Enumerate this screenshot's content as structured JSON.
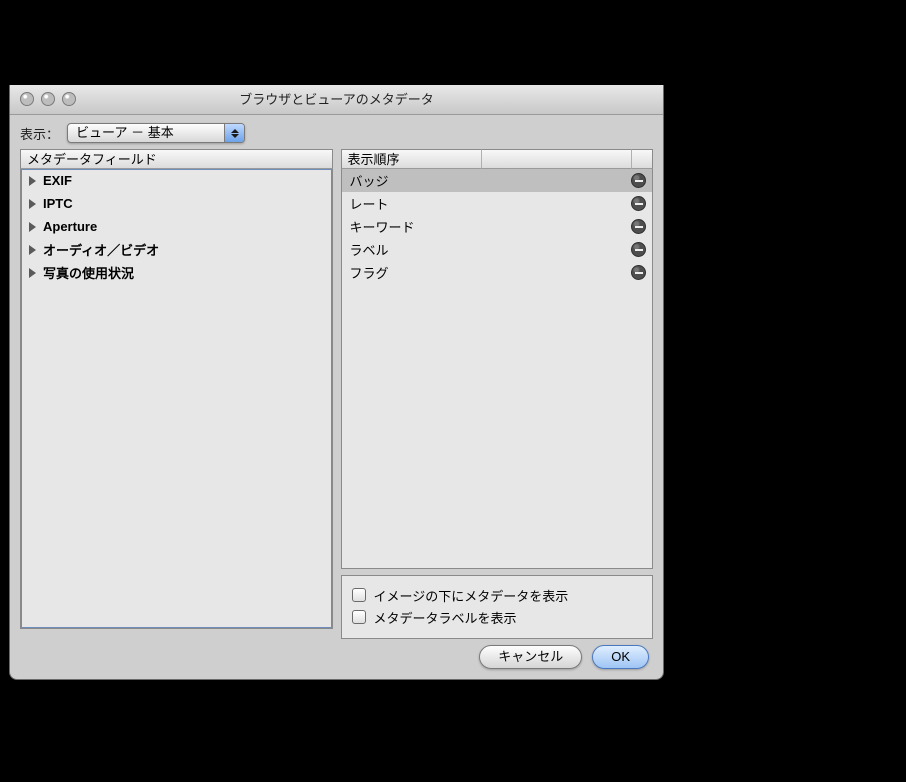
{
  "titlebar": {
    "title": "ブラウザとビューアのメタデータ"
  },
  "toprow": {
    "label": "表示：",
    "popup_value": "ビューア － 基本"
  },
  "left": {
    "header": "メタデータフィールド",
    "items": [
      {
        "label": "EXIF",
        "bold": true
      },
      {
        "label": "IPTC",
        "bold": true
      },
      {
        "label": "Aperture",
        "bold": true
      },
      {
        "label": "オーディオ／ビデオ",
        "bold": true
      },
      {
        "label": "写真の使用状況",
        "bold": true
      }
    ]
  },
  "right": {
    "header": "表示順序",
    "items": [
      {
        "label": "バッジ",
        "selected": true
      },
      {
        "label": "レート",
        "selected": false
      },
      {
        "label": "キーワード",
        "selected": false
      },
      {
        "label": "ラベル",
        "selected": false
      },
      {
        "label": "フラグ",
        "selected": false
      }
    ],
    "options": {
      "below_image": "イメージの下にメタデータを表示",
      "show_labels": "メタデータラベルを表示"
    }
  },
  "footer": {
    "cancel": "キャンセル",
    "ok": "OK"
  }
}
